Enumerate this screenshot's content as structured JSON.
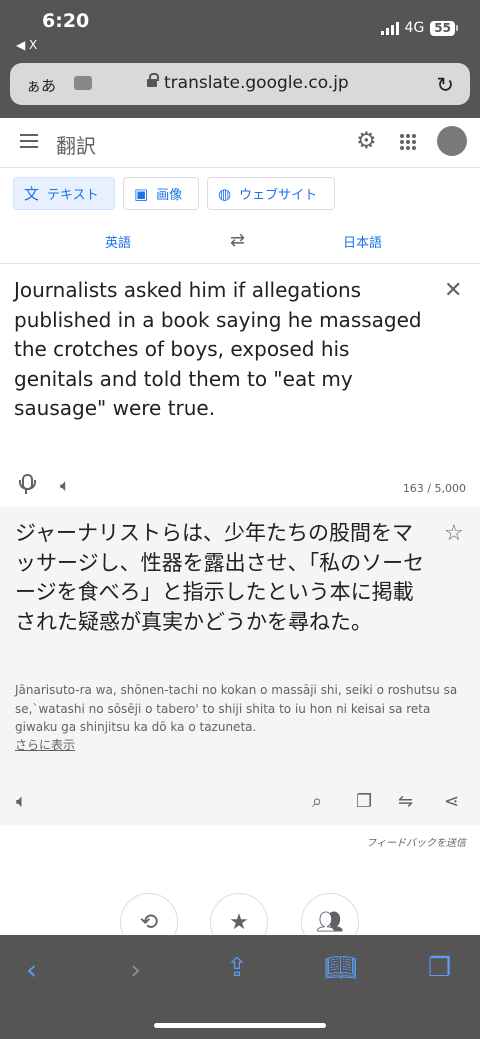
{
  "status": {
    "time": "6:20",
    "back_label": "◀ X",
    "network": "4G",
    "battery": "55"
  },
  "browser": {
    "aa": "ぁあ",
    "url": "translate.google.co.jp"
  },
  "header": {
    "title": "翻訳"
  },
  "modes": [
    {
      "label": "テキスト",
      "icon": "translate-icon"
    },
    {
      "label": "画像",
      "icon": "image-icon"
    },
    {
      "label": "ウェブサイト",
      "icon": "globe-icon"
    }
  ],
  "languages": {
    "source": "英語",
    "target": "日本語"
  },
  "source": {
    "text": "Journalists asked him if allegations published in a book saying he massaged the crotches of boys, exposed his genitals and told them to \"eat my sausage\" were true.",
    "char_count": "163 / 5,000"
  },
  "result": {
    "text": "ジャーナリストらは、少年たちの股間をマッサージし、性器を露出させ、「私のソーセージを食べろ」と指示したという本に掲載された疑惑が真実かどうかを尋ねた。",
    "romaji": "Jānarisuto-ra wa, shōnen-tachi no kokan o massāji shi, seiki o roshutsu sa se,`watashi no sōsēji o tabero' to shiji shita to iu hon ni keisai sa reta giwaku ga shinjitsu ka dō ka o tazuneta.",
    "show_more": "さらに表示"
  },
  "feedback": "フィードバックを送信",
  "colors": {
    "accent": "#1a73e8",
    "chrome": "#555555",
    "safari_blue": "#5b9cf2"
  }
}
